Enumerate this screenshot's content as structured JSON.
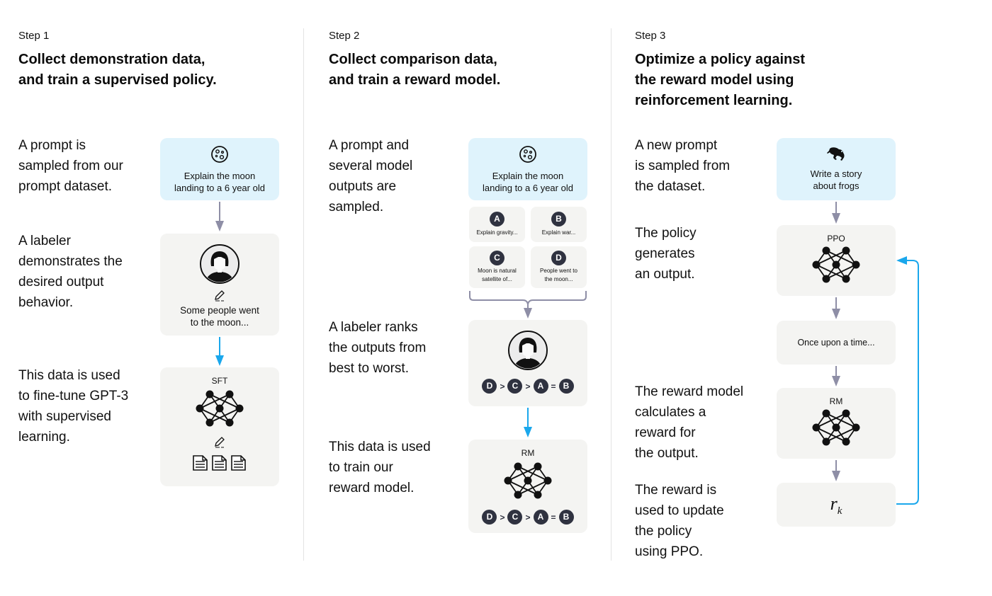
{
  "colors": {
    "prompt_box": "#dff3fc",
    "neutral_box": "#f4f4f2",
    "gray_arrow": "#8e8ea6",
    "blue_arrow": "#1aa7ec",
    "letter_badge": "#2f3240"
  },
  "steps": [
    {
      "label": "Step 1",
      "title_lines": [
        "Collect demonstration data,",
        "and train a supervised policy."
      ],
      "descriptions": [
        [
          "A prompt is",
          "sampled from our",
          "prompt dataset."
        ],
        [
          "A labeler",
          "demonstrates the",
          "desired output",
          "behavior."
        ],
        [
          "This data is used",
          "to fine-tune GPT-3",
          "with supervised",
          "learning."
        ]
      ],
      "prompt": {
        "icon": "moon-icon",
        "lines": [
          "Explain the moon",
          "landing to a 6 year old"
        ]
      },
      "labeler": {
        "icon": "labeler-avatar-icon",
        "edit_icon": "pencil-icon",
        "lines": [
          "Some people went",
          "to the moon..."
        ]
      },
      "model": {
        "label": "SFT",
        "icon": "neural-network-icon",
        "edit_icon": "pencil-icon",
        "doc_icons": [
          "document-icon",
          "document-icon",
          "document-icon"
        ]
      }
    },
    {
      "label": "Step 2",
      "title_lines": [
        "Collect comparison data,",
        "and train a reward model."
      ],
      "descriptions": [
        [
          "A prompt and",
          "several model",
          "outputs are",
          "sampled."
        ],
        [
          "A labeler ranks",
          "the outputs from",
          "best to worst."
        ],
        [
          "This data is used",
          "to train our",
          "reward model."
        ]
      ],
      "prompt": {
        "icon": "moon-icon",
        "lines": [
          "Explain the moon",
          "landing to a 6 year old"
        ]
      },
      "outputs": [
        {
          "letter": "A",
          "lines": [
            "Explain gravity..."
          ]
        },
        {
          "letter": "B",
          "lines": [
            "Explain war..."
          ]
        },
        {
          "letter": "C",
          "lines": [
            "Moon is natural",
            "satellite of..."
          ]
        },
        {
          "letter": "D",
          "lines": [
            "People went to",
            "the moon..."
          ]
        }
      ],
      "ranking": [
        "D",
        ">",
        "C",
        ">",
        "A",
        "=",
        "B"
      ],
      "model": {
        "label": "RM",
        "icon": "neural-network-icon"
      }
    },
    {
      "label": "Step 3",
      "title_lines": [
        "Optimize a policy against",
        "the reward model using",
        "reinforcement learning."
      ],
      "descriptions": [
        [
          "A new prompt",
          "is sampled from",
          "the dataset."
        ],
        [
          "The policy",
          "generates",
          "an output."
        ],
        [
          "The reward model",
          "calculates a",
          "reward for",
          "the output."
        ],
        [
          "The reward is",
          "used to update",
          "the policy",
          "using PPO."
        ]
      ],
      "prompt": {
        "icon": "frog-icon",
        "lines": [
          "Write a story",
          "about frogs"
        ]
      },
      "policy": {
        "label": "PPO",
        "icon": "neural-network-icon"
      },
      "output": {
        "text": "Once upon a time..."
      },
      "reward_model": {
        "label": "RM",
        "icon": "neural-network-icon"
      },
      "reward": {
        "symbol": "r",
        "subscript": "k"
      }
    }
  ]
}
